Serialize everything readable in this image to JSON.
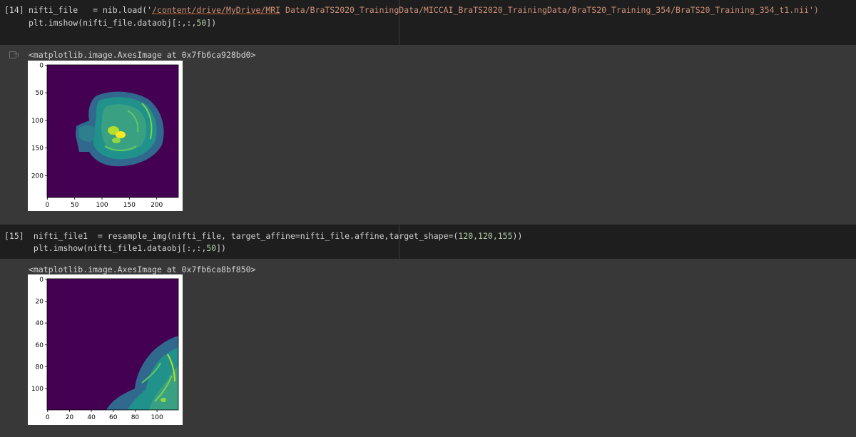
{
  "cells": [
    {
      "prompt": "[14]",
      "code": {
        "line1_a": "nifti_file   = nib.load('",
        "line1_link": "/content/drive/MyDrive/MRI",
        "line1_b": " Data/BraTS2020_TrainingData/MICCAI_BraTS2020_TrainingData/BraTS20_Training_354/BraTS20_Training_354_t1.nii",
        "line1_c": "')",
        "line2_a": "plt.imshow(nifti_file.dataobj[:,:,",
        "line2_num": "50",
        "line2_b": "])"
      },
      "output_text": "<matplotlib.image.AxesImage at 0x7fb6ca928bd0>",
      "plot": {
        "x_ticks": [
          "0",
          "50",
          "100",
          "150",
          "200"
        ],
        "y_ticks": [
          "0",
          "50",
          "100",
          "150",
          "200"
        ]
      }
    },
    {
      "prompt": "[15]",
      "code": {
        "line1_a": " nifti_file1  = resample_img(nifti_file, target_affine=nifti_file.affine,target_shape=(",
        "line1_nums": "120,120,155",
        "line1_b": "))",
        "line2_a": " plt.imshow(nifti_file1.dataobj[:,:,",
        "line2_num": "50",
        "line2_b": "])"
      },
      "output_text": "<matplotlib.image.AxesImage at 0x7fb6ca8bf850>",
      "plot": {
        "x_ticks": [
          "0",
          "20",
          "40",
          "60",
          "80",
          "100"
        ],
        "y_ticks": [
          "0",
          "20",
          "40",
          "60",
          "80",
          "100"
        ]
      }
    }
  ],
  "icons": {
    "output": "output-arrow-icon"
  },
  "colors": {
    "plot_background": "#440154",
    "tissue_dark": "#31688e",
    "tissue_mid": "#21918c",
    "tissue_light": "#5ec962",
    "tissue_bright": "#fde725"
  }
}
